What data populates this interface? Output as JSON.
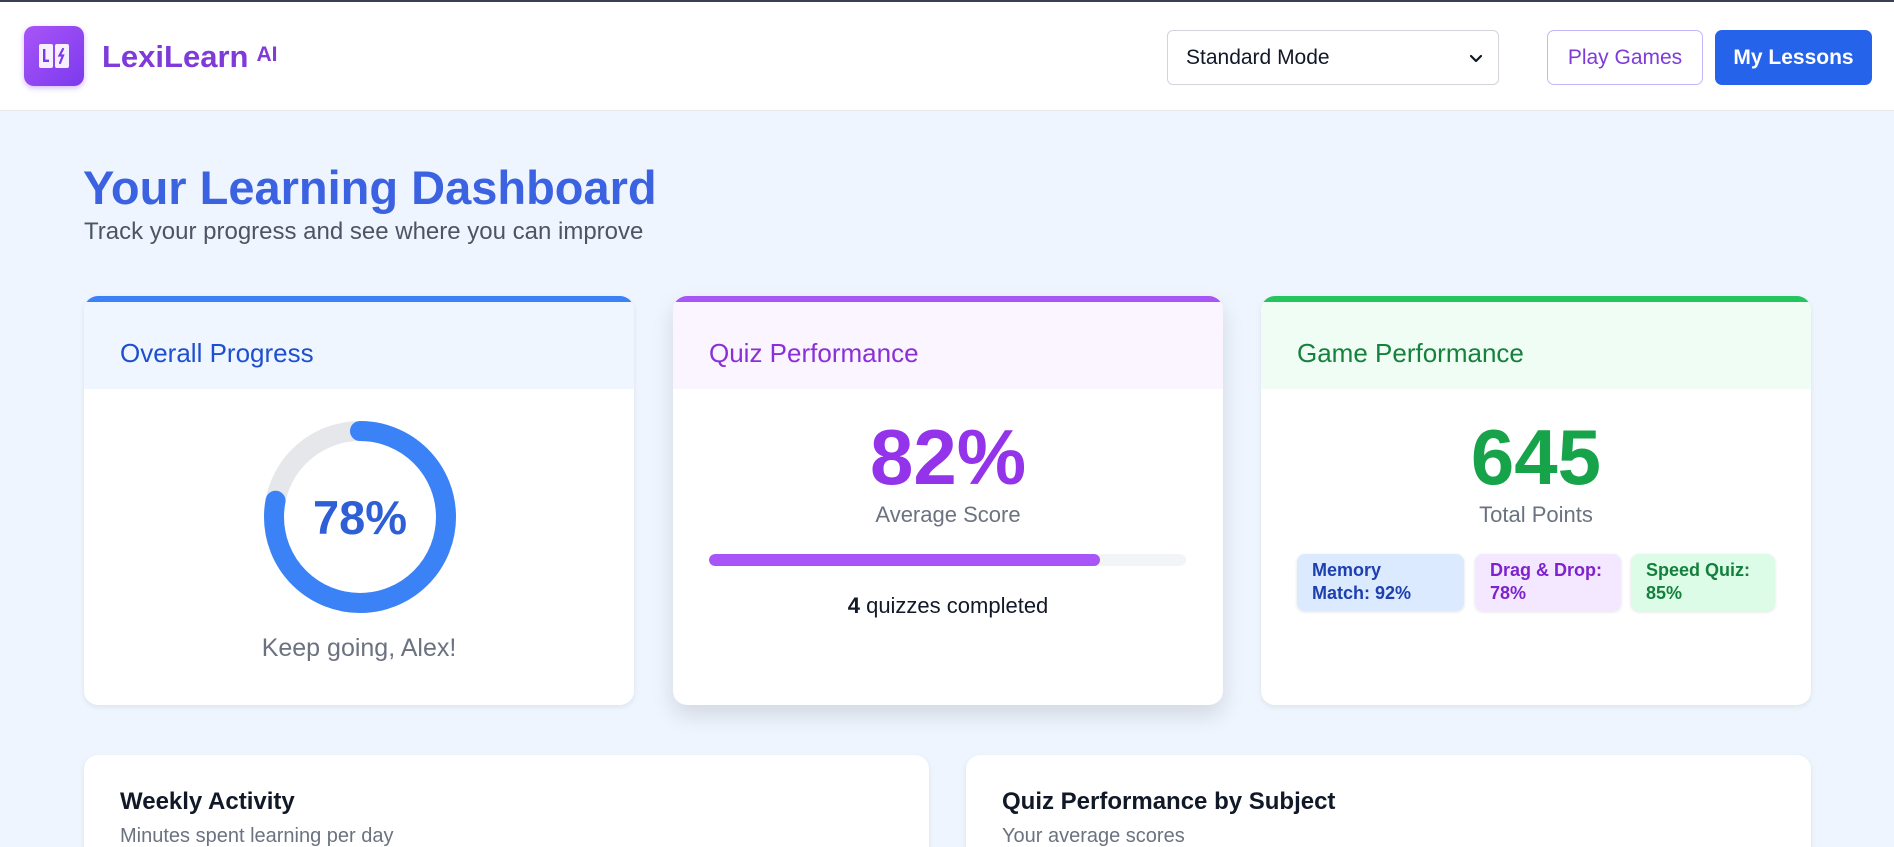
{
  "header": {
    "brand_name": "LexiLearn",
    "brand_suffix": "AI",
    "mode_select": {
      "selected": "Standard Mode",
      "options": [
        "Standard Mode"
      ]
    },
    "play_games_label": "Play Games",
    "my_lessons_label": "My Lessons"
  },
  "page": {
    "title": "Your Learning Dashboard",
    "subtitle": "Track your progress and see where you can improve"
  },
  "overall_progress": {
    "title": "Overall Progress",
    "percent": 78,
    "percent_label": "78%",
    "message": "Keep going, Alex!"
  },
  "quiz_performance": {
    "title": "Quiz Performance",
    "average": "82%",
    "average_label": "Average Score",
    "progress_fraction": 0.82,
    "completed_count": "4",
    "completed_suffix": "quizzes completed"
  },
  "game_performance": {
    "title": "Game Performance",
    "points": "645",
    "points_label": "Total Points",
    "games": [
      {
        "line1": "Memory",
        "line2": "Match: 92%"
      },
      {
        "line1": "Drag & Drop:",
        "line2": "78%"
      },
      {
        "line1": "Speed Quiz:",
        "line2": "85%"
      }
    ]
  },
  "weekly_activity": {
    "title": "Weekly Activity",
    "subtitle": "Minutes spent learning per day"
  },
  "quiz_by_subject": {
    "title": "Quiz Performance by Subject",
    "subtitle": "Your average scores"
  },
  "colors": {
    "blue": "#3b82f6",
    "purple": "#a855f7",
    "green": "#22c55e",
    "brand": "#7e3bd9",
    "primary_button": "#2563eb"
  },
  "icons": {
    "logo": "book-icon",
    "select_arrow": "chevron-down-icon"
  }
}
